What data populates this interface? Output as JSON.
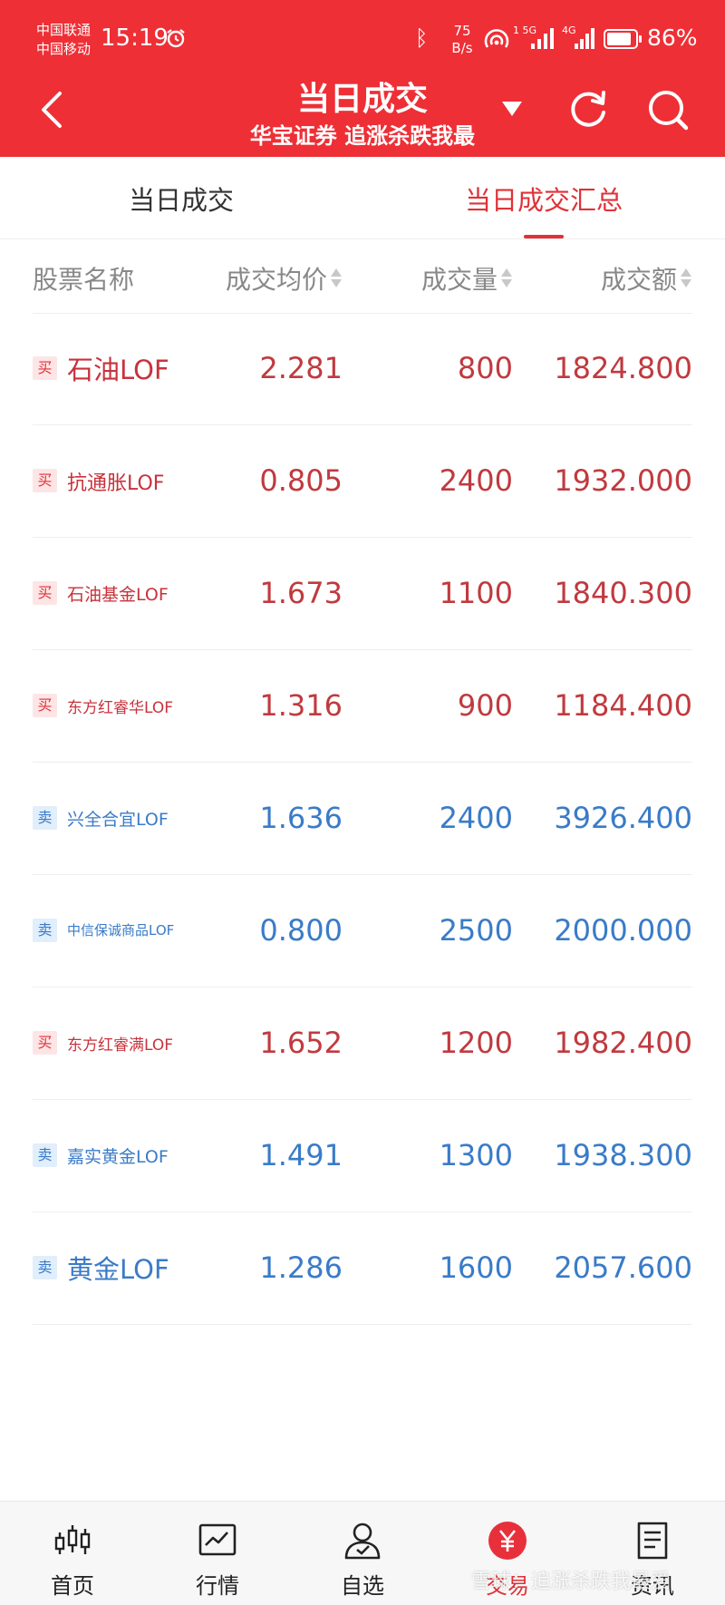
{
  "status_bar": {
    "carrier1": "中国联通",
    "carrier2": "中国移动",
    "time": "15:19",
    "net_speed_value": "75",
    "net_speed_unit": "B/s",
    "battery": "86%",
    "battery_level": 0.86
  },
  "header": {
    "title": "当日成交",
    "subtitle": "华宝证券 追涨杀跌我最",
    "bg_color": "#ee2f36"
  },
  "tabs": [
    {
      "label": "当日成交",
      "active": false
    },
    {
      "label": "当日成交汇总",
      "active": true
    }
  ],
  "table": {
    "columns": [
      "股票名称",
      "成交均价",
      "成交量",
      "成交额"
    ],
    "rows": [
      {
        "side": "买",
        "name": "石油LOF",
        "avg_price": "2.281",
        "volume": "800",
        "amount": "1824.800"
      },
      {
        "side": "买",
        "name": "抗通胀LOF",
        "avg_price": "0.805",
        "volume": "2400",
        "amount": "1932.000"
      },
      {
        "side": "买",
        "name": "石油基金LOF",
        "avg_price": "1.673",
        "volume": "1100",
        "amount": "1840.300"
      },
      {
        "side": "买",
        "name": "东方红睿华LOF",
        "avg_price": "1.316",
        "volume": "900",
        "amount": "1184.400"
      },
      {
        "side": "卖",
        "name": "兴全合宜LOF",
        "avg_price": "1.636",
        "volume": "2400",
        "amount": "3926.400"
      },
      {
        "side": "卖",
        "name": "中信保诚商品LOF",
        "avg_price": "0.800",
        "volume": "2500",
        "amount": "2000.000"
      },
      {
        "side": "买",
        "name": "东方红睿满LOF",
        "avg_price": "1.652",
        "volume": "1200",
        "amount": "1982.400"
      },
      {
        "side": "卖",
        "name": "嘉实黄金LOF",
        "avg_price": "1.491",
        "volume": "1300",
        "amount": "1938.300"
      },
      {
        "side": "卖",
        "name": "黄金LOF",
        "avg_price": "1.286",
        "volume": "1600",
        "amount": "2057.600"
      }
    ],
    "colors": {
      "buy": "#c8323c",
      "sell": "#3a7bc8"
    }
  },
  "bottom_nav": [
    {
      "label": "首页",
      "icon": "candlestick-icon"
    },
    {
      "label": "行情",
      "icon": "chart-line-icon"
    },
    {
      "label": "自选",
      "icon": "person-check-icon"
    },
    {
      "label": "交易",
      "icon": "yuan-icon",
      "active": true
    },
    {
      "label": "资讯",
      "icon": "document-icon"
    }
  ],
  "watermark": "雪球：追涨杀跌我最爱"
}
